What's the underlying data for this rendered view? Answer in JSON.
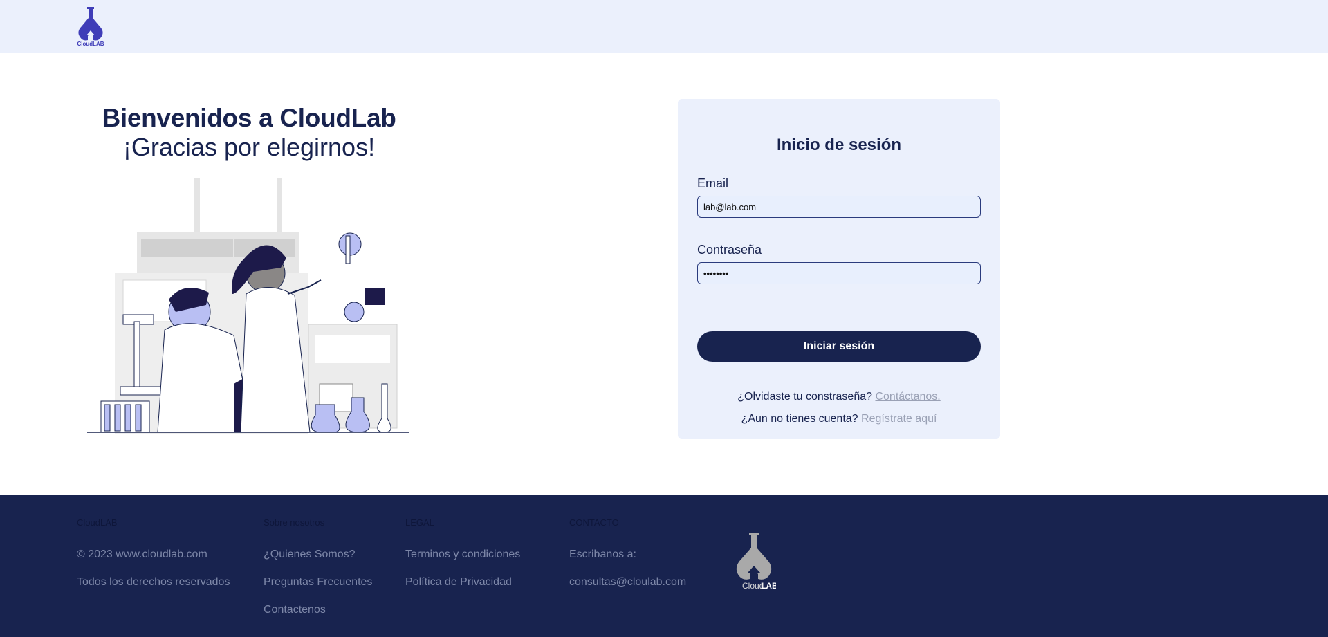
{
  "header": {
    "logo_text": "CloudLAB"
  },
  "welcome": {
    "title": "Bienvenidos a CloudLab",
    "subtitle": "¡Gracias por elegirnos!"
  },
  "login": {
    "title": "Inicio de sesión",
    "email_label": "Email",
    "email_value": "lab@lab.com",
    "password_label": "Contraseña",
    "password_value": "••••••••",
    "submit_label": "Iniciar sesión",
    "forgot_text": "¿Olvidaste tu constraseña?",
    "forgot_link": "Contáctanos.",
    "register_text": "¿Aun no tienes cuenta?",
    "register_link": "Regístrate aquí"
  },
  "footer": {
    "col1": {
      "heading": "CloudLAB",
      "links": [
        "© 2023 www.cloudlab.com",
        "Todos los derechos reservados"
      ]
    },
    "col2": {
      "heading": "Sobre nosotros",
      "links": [
        "¿Quienes Somos?",
        "Preguntas Frecuentes",
        "Contactenos"
      ]
    },
    "col3": {
      "heading": "LEGAL",
      "links": [
        "Terminos y condiciones",
        "Política de Privacidad"
      ]
    },
    "col4": {
      "heading": "CONTACTO",
      "links": [
        "Escribanos a:",
        "consultas@cloulab.com"
      ]
    },
    "logo_text_light": "Cloud",
    "logo_text_bold": "LAB"
  },
  "colors": {
    "navy": "#18234f",
    "header_bg": "#ebf0fc",
    "accent_purple": "#3f3db8",
    "muted_link": "#9aa1b5"
  }
}
